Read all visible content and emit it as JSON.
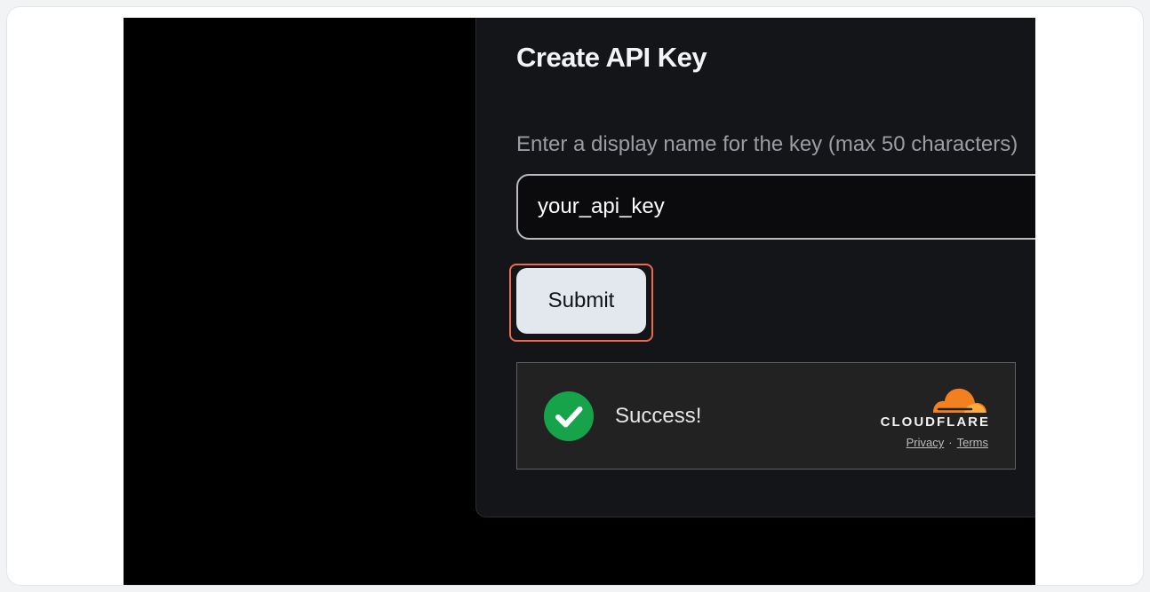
{
  "dialog": {
    "title": "Create API Key",
    "field_label": "Enter a display name for the key (max 50 characters)",
    "input_value": "your_api_key",
    "submit_label": "Submit"
  },
  "turnstile": {
    "status_text": "Success!",
    "brand": "CLOUDFLARE",
    "privacy_label": "Privacy",
    "separator": "·",
    "terms_label": "Terms",
    "check_icon": "checkmark-circle-icon",
    "logo_icon": "cloudflare-cloud-icon"
  },
  "colors": {
    "highlight": "#ef6a4a",
    "success_green": "#16a34a",
    "cloudflare_orange": "#f38020"
  }
}
